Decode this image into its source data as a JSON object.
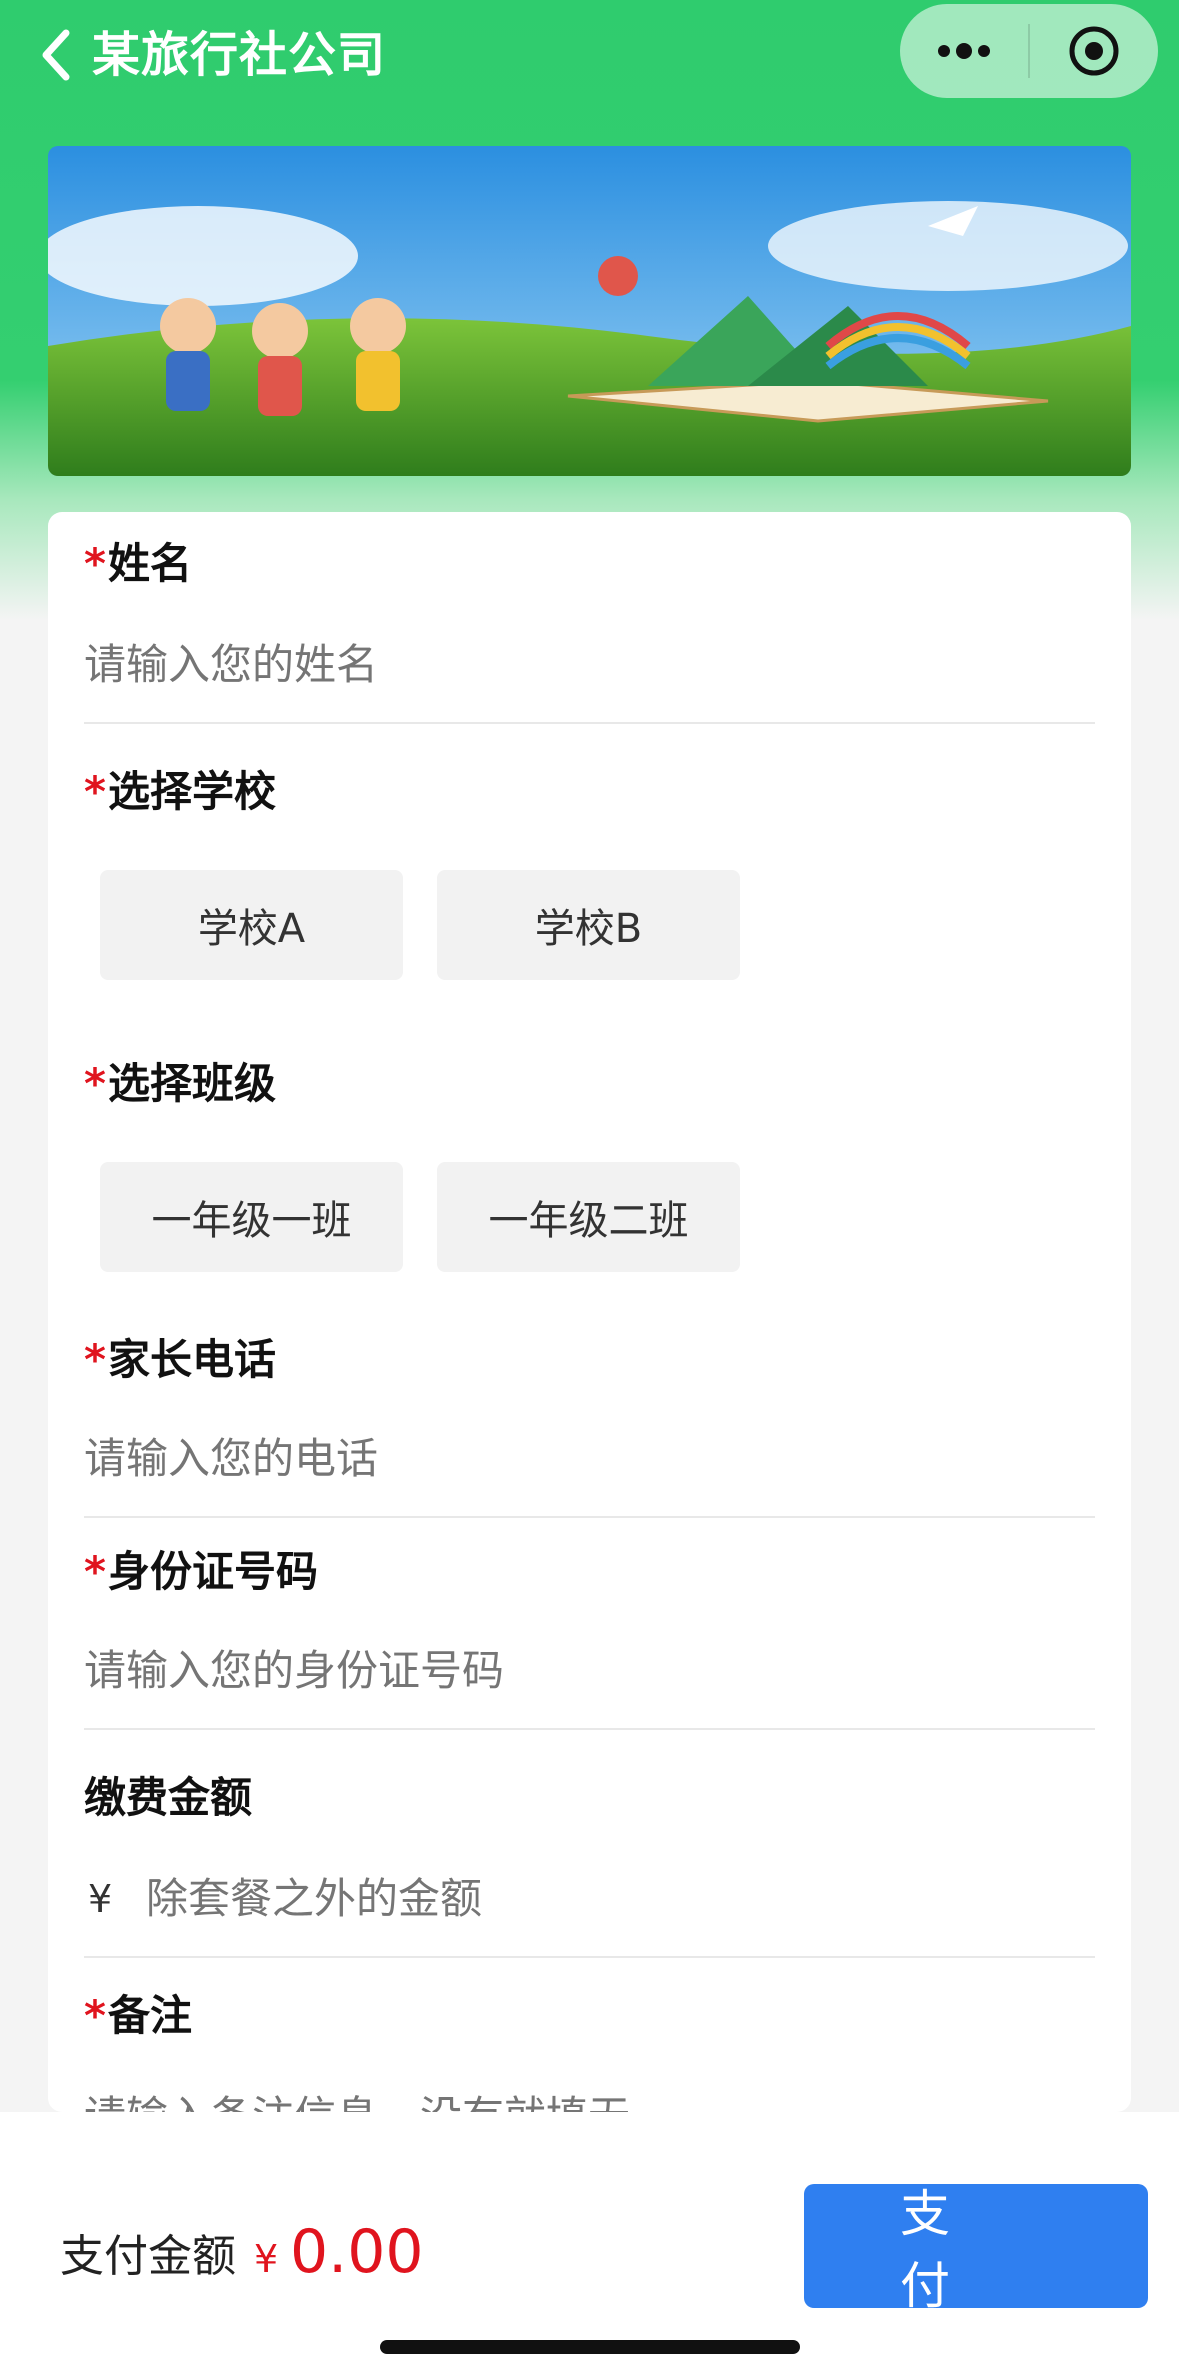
{
  "nav": {
    "title": "某旅行社公司",
    "back_icon": "chevron-left-icon",
    "more_icon": "more-dots-icon",
    "close_icon": "target-close-icon"
  },
  "banner": {
    "description_icon": "banner-image"
  },
  "form": {
    "name": {
      "label": "姓名",
      "required_mark": "*",
      "placeholder": "请输入您的姓名"
    },
    "school": {
      "label": "选择学校",
      "required_mark": "*",
      "options": [
        "学校A",
        "学校B"
      ]
    },
    "class": {
      "label": "选择班级",
      "required_mark": "*",
      "options": [
        "一年级一班",
        "一年级二班"
      ]
    },
    "phone": {
      "label": "家长电话",
      "required_mark": "*",
      "placeholder": "请输入您的电话"
    },
    "id_number": {
      "label": "身份证号码",
      "required_mark": "*",
      "placeholder": "请输入您的身份证号码"
    },
    "amount": {
      "label": "缴费金额",
      "currency": "¥",
      "placeholder": "除套餐之外的金额"
    },
    "remark": {
      "label": "备注",
      "required_mark": "*",
      "placeholder": "请输入备注信息，没有就填无"
    }
  },
  "footer": {
    "pay_label": "支付金额",
    "currency": "¥",
    "amount": "0.00",
    "pay_button": "支付"
  },
  "colors": {
    "brand_green": "#2fcc6e",
    "required_red": "#e0141e",
    "pay_blue": "#2f7ff0"
  }
}
